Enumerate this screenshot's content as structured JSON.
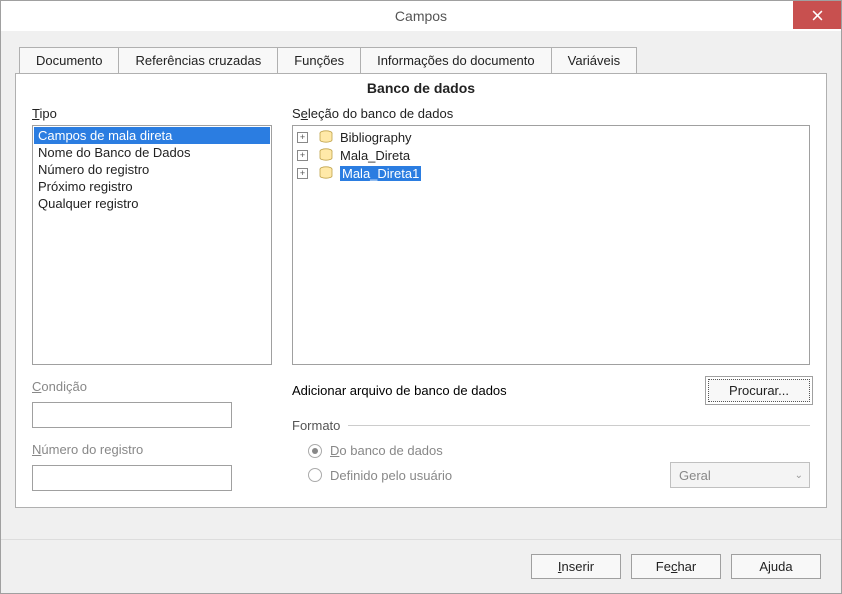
{
  "window": {
    "title": "Campos"
  },
  "tabs": {
    "items": [
      {
        "label": "Documento"
      },
      {
        "label": "Referências cruzadas"
      },
      {
        "label": "Funções"
      },
      {
        "label": "Informações do documento"
      },
      {
        "label": "Variáveis"
      }
    ],
    "active_panel_title": "Banco de dados"
  },
  "left": {
    "type_label_key": "T",
    "type_label_rest": "ipo",
    "type_items": [
      {
        "label": "Campos de mala direta",
        "selected": true
      },
      {
        "label": "Nome do Banco de Dados",
        "selected": false
      },
      {
        "label": "Número do registro",
        "selected": false
      },
      {
        "label": "Próximo registro",
        "selected": false
      },
      {
        "label": "Qualquer registro",
        "selected": false
      }
    ],
    "condition_label_key": "C",
    "condition_label_rest": "ondição",
    "condition_value": "",
    "recnum_label_key": "N",
    "recnum_label_rest": "úmero do registro",
    "recnum_value": ""
  },
  "right": {
    "selection_label_key": "S",
    "selection_label_rest": "eleção do banco de dados",
    "tree": [
      {
        "label": "Bibliography",
        "selected": false
      },
      {
        "label": "Mala_Direta",
        "selected": false
      },
      {
        "label": "Mala_Direta1",
        "selected": true
      }
    ],
    "add_db_label": "Adicionar arquivo de banco de dados",
    "browse_button": "Procurar...",
    "format_group_label": "Formato",
    "radio_db_key": "D",
    "radio_db_rest": "o banco de dados",
    "radio_user_label": "Definido pelo usuário",
    "format_select_value": "Geral"
  },
  "footer": {
    "insert_key": "I",
    "insert_rest": "nserir",
    "close_label_pre": "Fe",
    "close_key": "c",
    "close_rest": "har",
    "help_label_pre": "A",
    "help_key": "j",
    "help_rest": "uda"
  }
}
